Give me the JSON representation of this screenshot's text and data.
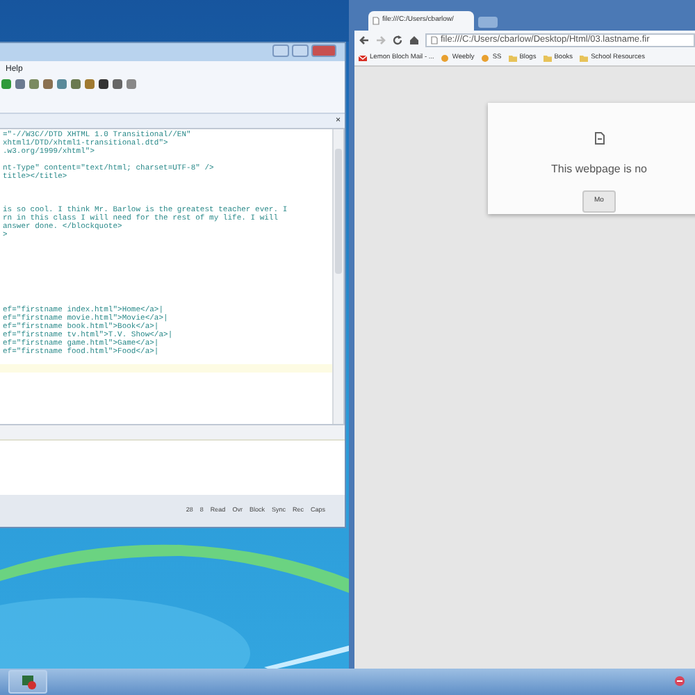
{
  "editor": {
    "menu": [
      "Help"
    ],
    "panel_close": "×",
    "code_lines": [
      {
        "kind": "code",
        "text": "=\"-//W3C//DTD XHTML 1.0 Transitional//EN\""
      },
      {
        "kind": "code",
        "text": "xhtml1/DTD/xhtml1-transitional.dtd\">"
      },
      {
        "kind": "code",
        "text": ".w3.org/1999/xhtml\">"
      },
      {
        "kind": "blank"
      },
      {
        "kind": "code",
        "text": "nt-Type\" content=\"text/html; charset=UTF-8\" />"
      },
      {
        "kind": "code",
        "text": "title></title>"
      },
      {
        "kind": "blank"
      },
      {
        "kind": "blank"
      },
      {
        "kind": "blank"
      },
      {
        "kind": "code",
        "text": "is so cool. I think Mr. Barlow is the greatest teacher ever. I"
      },
      {
        "kind": "code",
        "text": "rn in this class I will need for the rest of my life. I will"
      },
      {
        "kind": "code",
        "text": "answer done. </blockquote>"
      },
      {
        "kind": "code",
        "text": ">"
      },
      {
        "kind": "blank"
      },
      {
        "kind": "blank"
      },
      {
        "kind": "blank"
      },
      {
        "kind": "blank"
      },
      {
        "kind": "blank"
      },
      {
        "kind": "blank"
      },
      {
        "kind": "blank"
      },
      {
        "kind": "blank"
      },
      {
        "kind": "code",
        "text": "ef=\"firstname index.html\">Home</a>|"
      },
      {
        "kind": "code",
        "text": "ef=\"firstname movie.html\">Movie</a>|"
      },
      {
        "kind": "code",
        "text": "ef=\"firstname book.html\">Book</a>|"
      },
      {
        "kind": "code",
        "text": "ef=\"firstname tv.html\">T.V. Show</a>|"
      },
      {
        "kind": "code",
        "text": "ef=\"firstname game.html\">Game</a>|"
      },
      {
        "kind": "code",
        "text": "ef=\"firstname food.html\">Food</a>|"
      },
      {
        "kind": "blank"
      },
      {
        "kind": "current"
      }
    ],
    "status_bar": [
      "28",
      "8",
      "Read",
      "Ovr",
      "Block",
      "Sync",
      "Rec",
      "Caps"
    ]
  },
  "browser": {
    "tab": {
      "title": "file:///C:/Users/cbarlow/"
    },
    "address": "file:///C:/Users/cbarlow/Desktop/Html/03.lastname.fir",
    "bookmarks": [
      {
        "kind": "mail",
        "label": "Lemon Bloch Mail - ..."
      },
      {
        "kind": "site",
        "label": "Weebly"
      },
      {
        "kind": "site",
        "label": "SS"
      },
      {
        "kind": "folder",
        "label": "Blogs"
      },
      {
        "kind": "folder",
        "label": "Books"
      },
      {
        "kind": "folder",
        "label": "School Resources"
      }
    ],
    "error": {
      "message": "This webpage is no",
      "button": "Mo"
    }
  }
}
